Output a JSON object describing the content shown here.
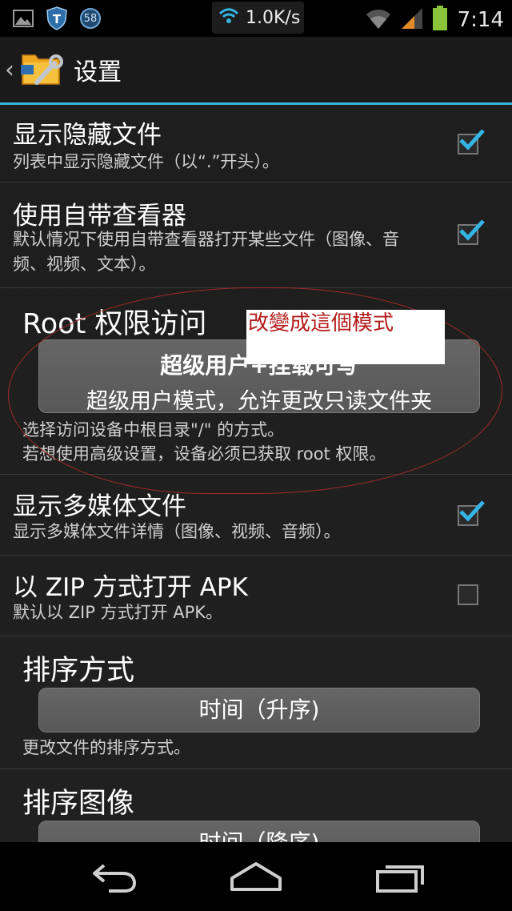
{
  "status_bar": {
    "notification_badge": "58",
    "net_speed": "1.0K/s",
    "time": "7:14",
    "icons": [
      "image-icon",
      "shield-icon",
      "badge-icon",
      "wifi-icon",
      "wifi-signal-icon",
      "cell-signal-icon",
      "battery-icon"
    ]
  },
  "action_bar": {
    "title": "设置",
    "accent_color": "#33b5e5"
  },
  "prefs": {
    "show_hidden": {
      "title": "显示隐藏文件",
      "summary": "列表中显示隐藏文件（以“.”开头）。",
      "checked": true
    },
    "builtin_viewer": {
      "title": "使用自带查看器",
      "summary": "默认情况下使用自带查看器打开某些文件（图像、音频、视频、文本）。",
      "checked": true
    },
    "root_access": {
      "title": "Root 权限访问",
      "button_line1": "超级用户+挂载可写",
      "button_line2": "超级用户模式，允许更改只读文件夹",
      "summary_line1": "选择访问设备中根目录\"/\" 的方式。",
      "summary_line2": "若想使用高级设置，设备必须已获取 root 权限。"
    },
    "show_media": {
      "title": "显示多媒体文件",
      "summary": "显示多媒体文件详情（图像、视频、音频）。",
      "checked": true
    },
    "open_apk_zip": {
      "title": "以 ZIP 方式打开 APK",
      "summary": "默认以 ZIP 方式打开 APK。",
      "checked": false
    },
    "sort_mode": {
      "title": "排序方式",
      "value": "时间（升序)",
      "summary": "更改文件的排序方式。"
    },
    "sort_images": {
      "title": "排序图像",
      "value": "时间（降序)"
    }
  },
  "annotation": {
    "text": "改變成這個模式"
  }
}
